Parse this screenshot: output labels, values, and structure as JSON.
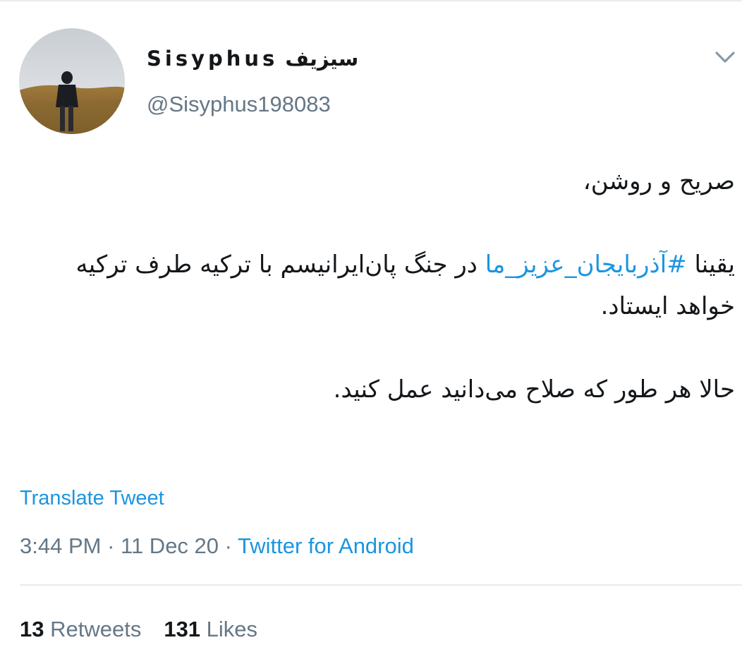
{
  "user": {
    "display_name_latin": "Sisyphus",
    "display_name_persian": "سیزیف",
    "handle": "@Sisyphus198083",
    "avatar_icon": "avatar-photo-person-in-field"
  },
  "tweet": {
    "line1": "صریح و روشن،",
    "line2_prefix": "یقینا ",
    "hashtag": "#آذربایجان_عزیز_ما",
    "line2_suffix": " در جنگ پان‌ایرانیسم با ترکیه طرف ترکیه خواهد ایستاد.",
    "line3": "حالا هر طور که صلاح می‌دانید عمل کنید."
  },
  "translate_label": "Translate Tweet",
  "meta": {
    "time": "3:44 PM",
    "separator1": " · ",
    "date": "11 Dec 20",
    "separator2": " · ",
    "source": "Twitter for Android"
  },
  "stats": {
    "retweets_count": "13",
    "retweets_label": " Retweets",
    "likes_count": "131",
    "likes_label": " Likes"
  },
  "colors": {
    "link": "#1b95e0",
    "secondary_text": "#657786",
    "primary_text": "#14171a",
    "divider": "#e6ecf0"
  },
  "icons": {
    "more_options": "chevron-down-icon"
  }
}
